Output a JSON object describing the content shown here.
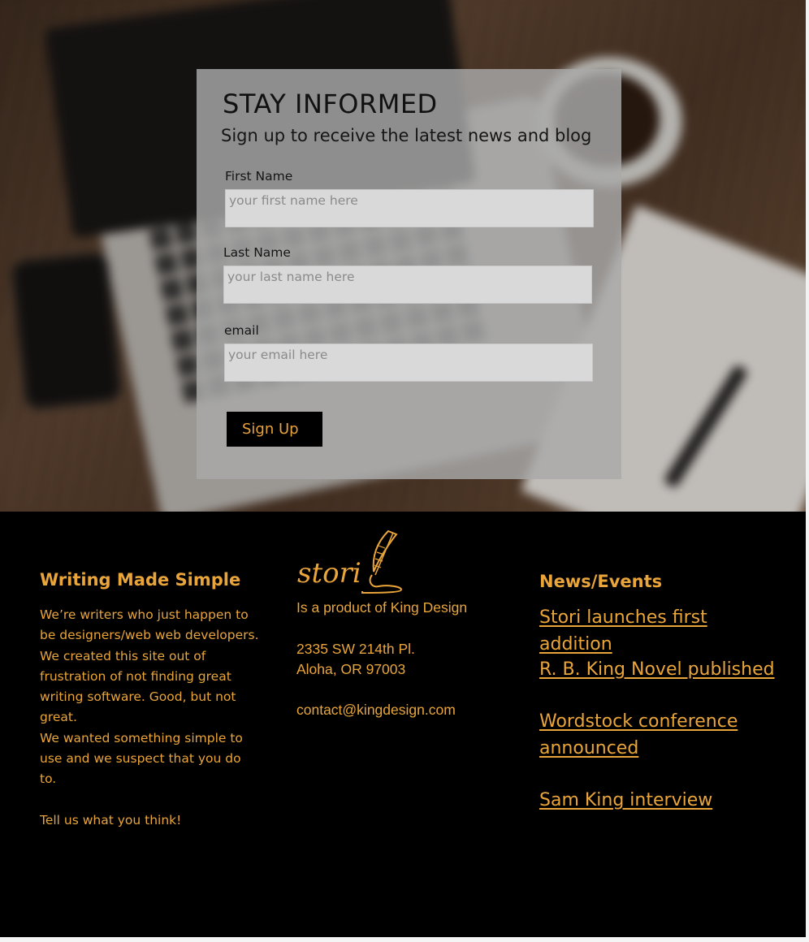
{
  "signup": {
    "title": "STAY INFORMED",
    "subtitle": "Sign up to receive the latest news and blog",
    "first_name": {
      "label": "First Name",
      "placeholder": "your first name here",
      "value": ""
    },
    "last_name": {
      "label": "Last Name",
      "placeholder": "your last name here",
      "value": ""
    },
    "email": {
      "label": "email",
      "placeholder": "your email here",
      "value": ""
    },
    "submit_label": "Sign Up"
  },
  "footer": {
    "about": {
      "title": "Writing Made Simple",
      "lines": [
        "We’re writers who just happen to be designers/web web developers.",
        "We created this site out of frustration of not finding great writing software. Good, but not great.",
        "We wanted something simple to use and we suspect that you do to.",
        "Tell us what you think!"
      ]
    },
    "company": {
      "logo_text": "stori",
      "tagline": "Is a product of King Design",
      "address_line1": "2335 SW 214th Pl.",
      "address_line2": "Aloha, OR 97003",
      "email": "contact@kingdesign.com"
    },
    "news": {
      "title": "News/Events",
      "items": [
        "Stori launches first addition",
        "R. B. King Novel published",
        "Wordstock conference announced",
        "Sam King interview"
      ]
    }
  },
  "colors": {
    "accent": "#e9a53a",
    "footer_bg": "#000000",
    "card_bg": "#aaaaaa",
    "input_bg": "#d9d9d9"
  }
}
